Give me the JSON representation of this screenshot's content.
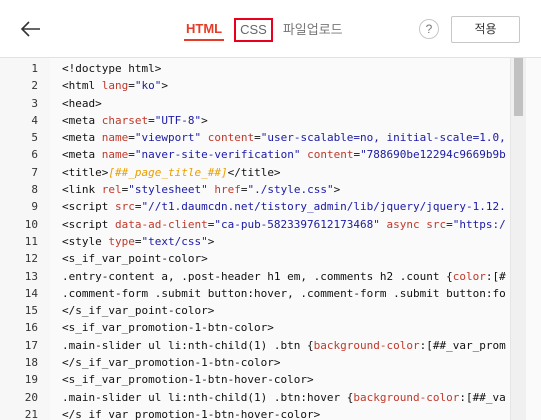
{
  "toolbar": {
    "back_label": "←",
    "tabs": [
      "HTML",
      "CSS",
      "파일업로드"
    ],
    "help_label": "?",
    "apply_label": "적용"
  },
  "colors": {
    "accent": "#e53c29",
    "highlight_box": "#e8001c",
    "tag": "#111111",
    "attr": "#c0392b",
    "value": "#1a1aa6",
    "var": "#e8a000"
  },
  "editor": {
    "lines": [
      {
        "n": "1",
        "segs": [
          [
            "plain",
            "<!doctype html>"
          ]
        ]
      },
      {
        "n": "2",
        "segs": [
          [
            "plain",
            "<html "
          ],
          [
            "attr",
            "lang"
          ],
          [
            "plain",
            "="
          ],
          [
            "value",
            "\"ko\""
          ],
          [
            "plain",
            ">"
          ]
        ]
      },
      {
        "n": "3",
        "segs": [
          [
            "plain",
            "<head>"
          ]
        ]
      },
      {
        "n": "4",
        "segs": [
          [
            "plain",
            "<meta "
          ],
          [
            "attr",
            "charset"
          ],
          [
            "plain",
            "="
          ],
          [
            "value",
            "\"UTF-8\""
          ],
          [
            "plain",
            ">"
          ]
        ]
      },
      {
        "n": "5",
        "segs": [
          [
            "plain",
            "<meta "
          ],
          [
            "attr",
            "name"
          ],
          [
            "plain",
            "="
          ],
          [
            "value",
            "\"viewport\""
          ],
          [
            "plain",
            " "
          ],
          [
            "attr",
            "content"
          ],
          [
            "plain",
            "="
          ],
          [
            "value",
            "\"user-scalable=no, initial-scale=1.0,"
          ]
        ]
      },
      {
        "n": "6",
        "segs": [
          [
            "plain",
            "<meta "
          ],
          [
            "attr",
            "name"
          ],
          [
            "plain",
            "="
          ],
          [
            "value",
            "\"naver-site-verification\""
          ],
          [
            "plain",
            " "
          ],
          [
            "attr",
            "content"
          ],
          [
            "plain",
            "="
          ],
          [
            "value",
            "\"788690be12294c9669b9b"
          ]
        ]
      },
      {
        "n": "7",
        "segs": [
          [
            "plain",
            "<title>"
          ],
          [
            "var",
            "[##_page_title_##]"
          ],
          [
            "plain",
            "</title>"
          ]
        ]
      },
      {
        "n": "8",
        "segs": [
          [
            "plain",
            "<link "
          ],
          [
            "attr",
            "rel"
          ],
          [
            "plain",
            "="
          ],
          [
            "value",
            "\"stylesheet\""
          ],
          [
            "plain",
            " "
          ],
          [
            "attr",
            "href"
          ],
          [
            "plain",
            "="
          ],
          [
            "value",
            "\"./style.css\""
          ],
          [
            "plain",
            ">"
          ]
        ]
      },
      {
        "n": "9",
        "segs": [
          [
            "plain",
            "<script "
          ],
          [
            "attr",
            "src"
          ],
          [
            "plain",
            "="
          ],
          [
            "value",
            "\"//t1.daumcdn.net/tistory_admin/lib/jquery/jquery-1.12."
          ]
        ]
      },
      {
        "n": "10",
        "segs": [
          [
            "plain",
            "<script "
          ],
          [
            "attr",
            "data-ad-client"
          ],
          [
            "plain",
            "="
          ],
          [
            "value",
            "\"ca-pub-5823397612173468\""
          ],
          [
            "plain",
            " "
          ],
          [
            "attr",
            "async"
          ],
          [
            "plain",
            " "
          ],
          [
            "attr",
            "src"
          ],
          [
            "plain",
            "="
          ],
          [
            "value",
            "\"https:/"
          ]
        ]
      },
      {
        "n": "11",
        "segs": [
          [
            "plain",
            "<style "
          ],
          [
            "attr",
            "type"
          ],
          [
            "plain",
            "="
          ],
          [
            "value",
            "\"text/css\""
          ],
          [
            "plain",
            ">"
          ]
        ]
      },
      {
        "n": "12",
        "segs": [
          [
            "plain",
            "<s_if_var_point-color>"
          ]
        ]
      },
      {
        "n": "13",
        "segs": [
          [
            "plain",
            ".entry-content a, .post-header h1 em, .comments h2 .count {"
          ],
          [
            "attr",
            "color"
          ],
          [
            "plain",
            ":[#"
          ]
        ]
      },
      {
        "n": "14",
        "segs": [
          [
            "plain",
            ".comment-form .submit button:hover, .comment-form .submit button:fo"
          ]
        ]
      },
      {
        "n": "15",
        "segs": [
          [
            "plain",
            "</s_if_var_point-color>"
          ]
        ]
      },
      {
        "n": "16",
        "segs": [
          [
            "plain",
            "<s_if_var_promotion-1-btn-color>"
          ]
        ]
      },
      {
        "n": "17",
        "segs": [
          [
            "plain",
            ".main-slider ul li:nth-child(1) .btn {"
          ],
          [
            "attr",
            "background-color"
          ],
          [
            "plain",
            ":[##_var_prom"
          ]
        ]
      },
      {
        "n": "18",
        "segs": [
          [
            "plain",
            "</s_if_var_promotion-1-btn-color>"
          ]
        ]
      },
      {
        "n": "19",
        "segs": [
          [
            "plain",
            "<s_if_var_promotion-1-btn-hover-color>"
          ]
        ]
      },
      {
        "n": "20",
        "segs": [
          [
            "plain",
            ".main-slider ul li:nth-child(1) .btn:hover {"
          ],
          [
            "attr",
            "background-color"
          ],
          [
            "plain",
            ":[##_va"
          ]
        ]
      },
      {
        "n": "21",
        "segs": [
          [
            "plain",
            "</s_if_var_promotion-1-btn-hover-color>"
          ]
        ]
      }
    ]
  }
}
